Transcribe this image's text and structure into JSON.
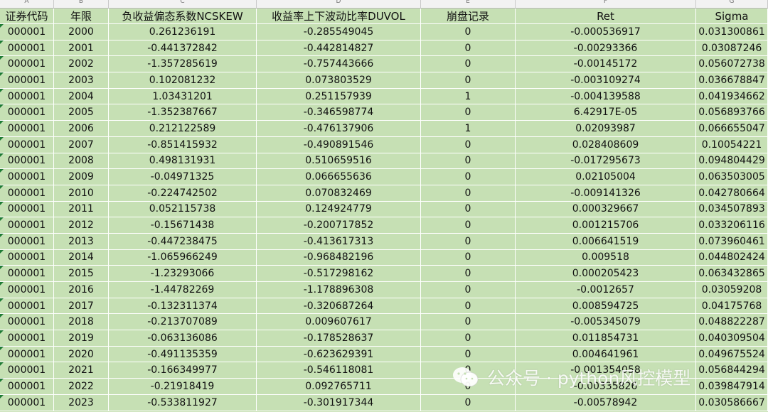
{
  "columns": [
    "A",
    "B",
    "C",
    "D",
    "E",
    "F",
    "G"
  ],
  "headers": [
    "证券代码",
    "年限",
    "负收益偏态系数NCSKEW",
    "收益率上下波动比率DUVOL",
    "崩盘记录",
    "Ret",
    "Sigma"
  ],
  "rows": [
    [
      "000001",
      "2000",
      "0.261236191",
      "-0.285549045",
      "0",
      "-0.000536917",
      "0.031300861"
    ],
    [
      "000001",
      "2001",
      "-0.441372842",
      "-0.442814827",
      "0",
      "-0.00293366",
      "0.03087246"
    ],
    [
      "000001",
      "2002",
      "-1.357285619",
      "-0.757443666",
      "0",
      "-0.00145172",
      "0.056072738"
    ],
    [
      "000001",
      "2003",
      "0.102081232",
      "0.073803529",
      "0",
      "-0.003109274",
      "0.036678847"
    ],
    [
      "000001",
      "2004",
      "1.03431201",
      "0.251157939",
      "1",
      "-0.004139588",
      "0.041934662"
    ],
    [
      "000001",
      "2005",
      "-1.352387667",
      "-0.346598774",
      "0",
      "6.42917E-05",
      "0.056893766"
    ],
    [
      "000001",
      "2006",
      "0.212122589",
      "-0.476137906",
      "1",
      "0.02093987",
      "0.066655047"
    ],
    [
      "000001",
      "2007",
      "-0.851415932",
      "-0.490891546",
      "0",
      "0.028408609",
      "0.10054221"
    ],
    [
      "000001",
      "2008",
      "0.498131931",
      "0.510659516",
      "0",
      "-0.017295673",
      "0.094804429"
    ],
    [
      "000001",
      "2009",
      "-0.04971325",
      "0.066655636",
      "0",
      "0.02105004",
      "0.063503005"
    ],
    [
      "000001",
      "2010",
      "-0.224742502",
      "0.070832469",
      "0",
      "-0.009141326",
      "0.042780664"
    ],
    [
      "000001",
      "2011",
      "0.052115738",
      "0.124924779",
      "0",
      "0.000329667",
      "0.034507893"
    ],
    [
      "000001",
      "2012",
      "-0.15671438",
      "-0.200717852",
      "0",
      "0.001215706",
      "0.033206116"
    ],
    [
      "000001",
      "2013",
      "-0.447238475",
      "-0.413617313",
      "0",
      "0.006641519",
      "0.073960461"
    ],
    [
      "000001",
      "2014",
      "-1.065966249",
      "-0.968482196",
      "0",
      "0.009518",
      "0.044802424"
    ],
    [
      "000001",
      "2015",
      "-1.23293066",
      "-0.517298162",
      "0",
      "0.000205423",
      "0.063432865"
    ],
    [
      "000001",
      "2016",
      "-1.44782269",
      "-1.178896308",
      "0",
      "-0.0012657",
      "0.03059208"
    ],
    [
      "000001",
      "2017",
      "-0.132311374",
      "-0.320687264",
      "0",
      "0.008594725",
      "0.04175768"
    ],
    [
      "000001",
      "2018",
      "-0.213707089",
      "0.009607617",
      "0",
      "-0.005345079",
      "0.048822287"
    ],
    [
      "000001",
      "2019",
      "-0.063136086",
      "-0.178528637",
      "0",
      "0.011854731",
      "0.040309504"
    ],
    [
      "000001",
      "2020",
      "-0.491135359",
      "-0.623629391",
      "0",
      "0.004641961",
      "0.049675524"
    ],
    [
      "000001",
      "2021",
      "-0.166349977",
      "-0.546118081",
      "0",
      "-0.001354058",
      "0.056844294"
    ],
    [
      "000001",
      "2022",
      "-0.21918419",
      "0.092765711",
      "0",
      "-0.00335826",
      "0.039847914"
    ],
    [
      "000001",
      "2023",
      "-0.533811927",
      "-0.301917344",
      "0",
      "-0.00578942",
      "0.030586667"
    ]
  ],
  "watermark": {
    "text": "公众号 · python风控模型",
    "icon": "wechat-icon"
  }
}
